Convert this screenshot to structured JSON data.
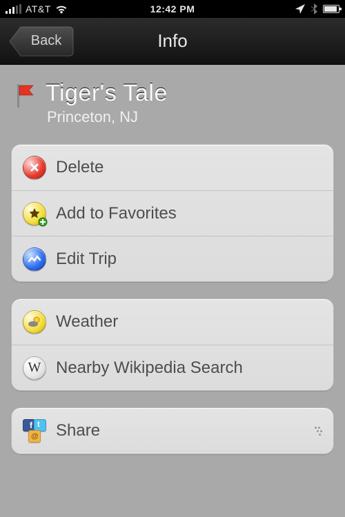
{
  "status": {
    "carrier": "AT&T",
    "time": "12:42 PM"
  },
  "nav": {
    "back_label": "Back",
    "title": "Info"
  },
  "place": {
    "flag_color": "#e53223",
    "title": "Tiger's Tale",
    "subtitle": "Princeton, NJ"
  },
  "group_actions": {
    "items": [
      {
        "icon": "delete-icon",
        "label": "Delete"
      },
      {
        "icon": "favorite-icon",
        "label": "Add to Favorites"
      },
      {
        "icon": "trip-icon",
        "label": "Edit Trip"
      }
    ]
  },
  "group_info": {
    "items": [
      {
        "icon": "weather-icon",
        "label": "Weather"
      },
      {
        "icon": "wikipedia-icon",
        "label": "Nearby Wikipedia Search"
      }
    ]
  },
  "group_share": {
    "items": [
      {
        "icon": "share-icon",
        "label": "Share"
      }
    ]
  }
}
